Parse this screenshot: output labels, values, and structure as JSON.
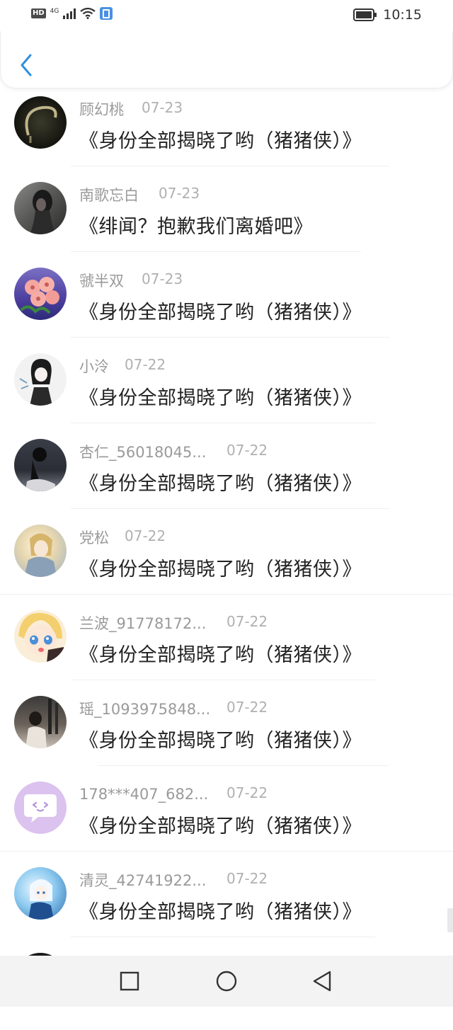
{
  "status_bar": {
    "hd": "HD",
    "network": "4G",
    "time": "10:15"
  },
  "comments": [
    {
      "name": "顾幻桃",
      "date": "07-23",
      "text": "《身份全部揭晓了哟（猪猪侠）》",
      "avatar": "dark-circle-frame"
    },
    {
      "name": "南歌忘白",
      "date": "07-23",
      "text": "《绯闻？抱歉我们离婚吧》",
      "avatar": "dark-girl-portrait"
    },
    {
      "name": "虢半双",
      "date": "07-23",
      "text": "《身份全部揭晓了哟（猪猪侠）》",
      "avatar": "pink-flowers"
    },
    {
      "name": "小泠",
      "date": "07-22",
      "text": "《身份全部揭晓了哟（猪猪侠）》",
      "avatar": "anime-girl-sketch"
    },
    {
      "name": "杏仁_56018045...",
      "date": "07-22",
      "text": "《身份全部揭晓了哟（猪猪侠）》",
      "avatar": "dark-silhouette"
    },
    {
      "name": "党松",
      "date": "07-22",
      "text": "《身份全部揭晓了哟（猪猪侠）》",
      "avatar": "fantasy-character"
    },
    {
      "name": "兰波_91778172...",
      "date": "07-22",
      "text": "《身份全部揭晓了哟（猪猪侠）》",
      "avatar": "blonde-anime-girl"
    },
    {
      "name": "瑶_1093975848...",
      "date": "07-22",
      "text": "《身份全部揭晓了哟（猪猪侠）》",
      "avatar": "city-photo"
    },
    {
      "name": "178***407_682...",
      "date": "07-22",
      "text": "《身份全部揭晓了哟（猪猪侠）》",
      "avatar": "chat-bubble-default"
    },
    {
      "name": "清灵_42741922...",
      "date": "07-22",
      "text": "《身份全部揭晓了哟（猪猪侠）》",
      "avatar": "blue-anime-art"
    }
  ],
  "nav": {
    "recents": "square-icon",
    "home": "circle-icon",
    "back": "triangle-back-icon"
  },
  "colors": {
    "accent_blue": "#2f8fdd",
    "name_gray": "#9a9a9a",
    "content_black": "#222222"
  }
}
